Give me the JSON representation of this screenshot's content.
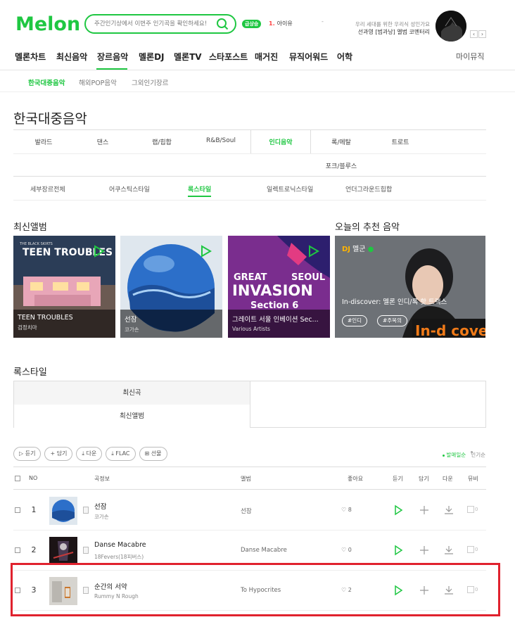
{
  "header": {
    "logo_text": "Melon",
    "search_placeholder": "주간인기상에서 이번주 인기곡을 확인하세요!",
    "rank_badge": "급상승",
    "rank_num": "1.",
    "rank_title": "아이유",
    "rank_dash": "-",
    "promo_line1": "우리 세대를 위한 우리식 성인가요",
    "promo_line2": "선과영 [범과낭] 앨범 코멘터리",
    "arrow_prev": "‹",
    "arrow_next": "›"
  },
  "gnb": {
    "items": [
      "멜론차트",
      "최신음악",
      "장르음악",
      "멜론DJ",
      "멜론TV",
      "스타포스트",
      "매거진",
      "뮤직어워드",
      "어학"
    ],
    "active": "장르음악",
    "mymusic": "마이뮤직"
  },
  "subnav": {
    "items": [
      "한국대중음악",
      "해외POP음악",
      "그외인기장르"
    ],
    "active": "한국대중음악"
  },
  "page_title": "한국대중음악",
  "genres": {
    "row1": [
      "발라드",
      "댄스",
      "랩/힙합",
      "R&B/Soul",
      "인디음악",
      "록/메탈",
      "트로트"
    ],
    "row2": [
      "포크/블루스"
    ],
    "active": "인디음악",
    "sub": [
      "세부장르전체",
      "어쿠스틱스타일",
      "록스타일",
      "일렉트로닉스타일",
      "언더그라운드힙합"
    ],
    "sub_active": "록스타일"
  },
  "new_albums": {
    "title": "최신앨범",
    "items": [
      {
        "title": "TEEN TROUBLES",
        "artist": "검정치마",
        "cover_text": "TEEN TROUBLES",
        "cover_small": "THE BLACK SKIRTS"
      },
      {
        "title": "선잠",
        "artist": "코가손"
      },
      {
        "title": "그레이트 서울 인베이션 Sec...",
        "artist": "Various Artists",
        "cover_l1": "GREAT",
        "cover_l1b": "SEOUL",
        "cover_l2": "INVASION",
        "cover_l3": "Section 6"
      }
    ]
  },
  "reco": {
    "title": "오늘의 추천 음악",
    "dj_badge": "DJ",
    "dj": "멜군",
    "playlist": "In-discover: 멜론 인디/록 핫 트랙스",
    "tags": [
      "#인디",
      "#주목의"
    ],
    "overlay_text": "In-d  cover"
  },
  "rock": {
    "title": "록스타일",
    "tabs": [
      "최신곡",
      "최신앨범"
    ],
    "buttons": [
      "듣기",
      "담기",
      "다운",
      "FLAC",
      "선물"
    ],
    "sort": [
      "발매일순",
      "인기순"
    ],
    "columns": {
      "no": "NO",
      "song": "곡정보",
      "album": "앨범",
      "like": "좋아요",
      "play": "듣기",
      "add": "담기",
      "down": "다운",
      "mv": "뮤비"
    },
    "songs": [
      {
        "no": "1",
        "title": "선잠",
        "artist": "코가손",
        "album": "선잠",
        "likes": "8",
        "mv": "0"
      },
      {
        "no": "2",
        "title": "Danse Macabre",
        "artist": "18Fevers(18피버스)",
        "album": "Danse Macabre",
        "likes": "0",
        "mv": "0"
      },
      {
        "no": "3",
        "title": "순간의 서약",
        "artist": "Rummy N Rough",
        "album": "To Hypocrites",
        "likes": "2",
        "mv": "0"
      }
    ]
  },
  "colors": {
    "accent": "#1fc742",
    "highlight": "#e0222e"
  }
}
